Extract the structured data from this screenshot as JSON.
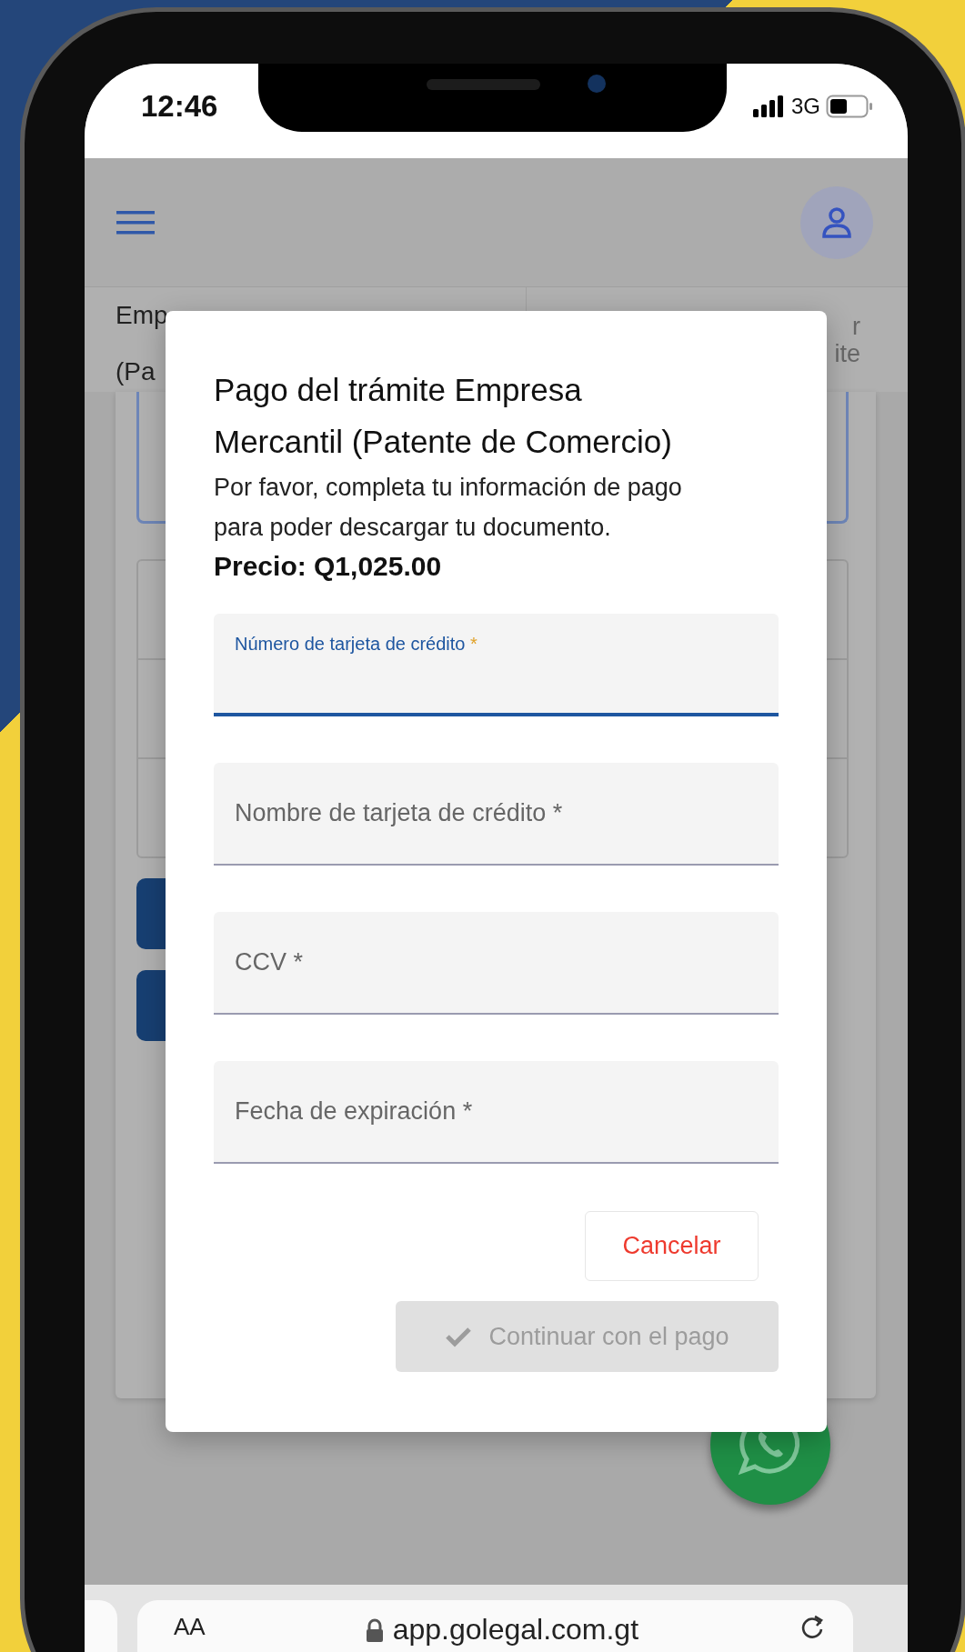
{
  "status_bar": {
    "time": "12:46",
    "network": "3G"
  },
  "tabs": [
    {
      "lines": [
        "Emp",
        "(Pa"
      ]
    },
    {
      "lines": [
        "r",
        "ite"
      ]
    }
  ],
  "dialog": {
    "title": "Pago del trámite Empresa Mercantil (Patente de Comercio)",
    "message": "Por favor, completa tu información de pago para poder descargar tu documento.",
    "price": "Precio: Q1,025.00",
    "fields": [
      {
        "label": "Número de tarjeta de crédito",
        "required_mark": "*",
        "focused": true
      },
      {
        "label": "Nombre de tarjeta de crédito",
        "required_mark": "*",
        "focused": false
      },
      {
        "label": "CCV",
        "required_mark": "*",
        "focused": false
      },
      {
        "label": "Fecha de expiración",
        "required_mark": "*",
        "focused": false
      }
    ],
    "buttons": [
      {
        "label": "Cancelar",
        "kind": "cancel",
        "disabled": false
      },
      {
        "label": "Continuar con el pago",
        "kind": "confirm",
        "disabled": true
      }
    ]
  },
  "browser_bar": {
    "text_size": "AA",
    "url": "app.golegal.com.gt"
  }
}
